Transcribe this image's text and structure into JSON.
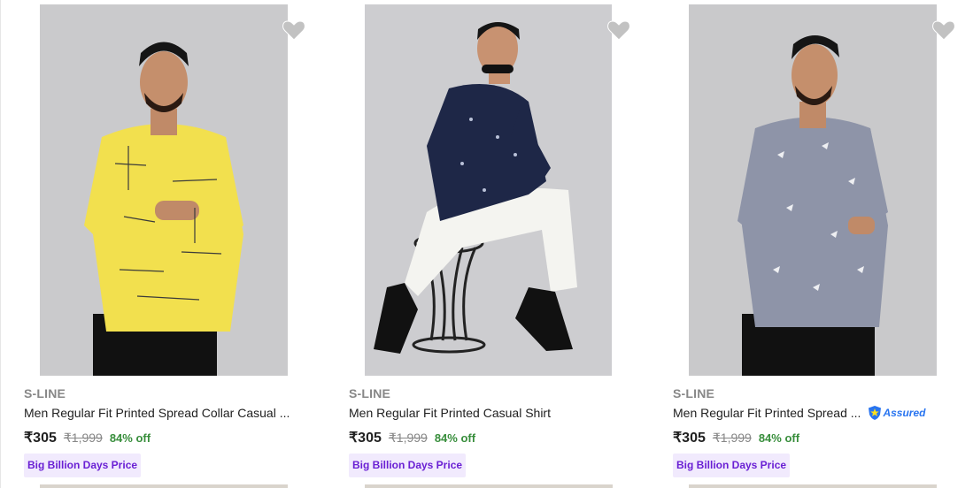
{
  "products": [
    {
      "brand": "S-LINE",
      "title": "Men Regular Fit Printed Spread Collar Casual ...",
      "price": "₹305",
      "mrp": "₹1,999",
      "discount": "84% off",
      "badge": "Big Billion Days Price",
      "assured": "",
      "shirt_color": "#f2e04e",
      "wishlist_icon": "heart-icon"
    },
    {
      "brand": "S-LINE",
      "title": "Men Regular Fit Printed Casual Shirt",
      "price": "₹305",
      "mrp": "₹1,999",
      "discount": "84% off",
      "badge": "Big Billion Days Price",
      "assured": "",
      "shirt_color": "#1e2747",
      "wishlist_icon": "heart-icon"
    },
    {
      "brand": "S-LINE",
      "title": "Men Regular Fit Printed Spread ...",
      "price": "₹305",
      "mrp": "₹1,999",
      "discount": "84% off",
      "badge": "Big Billion Days Price",
      "assured": "Assured",
      "shirt_color": "#8e94a8",
      "wishlist_icon": "heart-icon"
    }
  ],
  "colors": {
    "price_off": "#388e3c",
    "badge_text": "#6a20d4",
    "badge_bg": "#f1eafd",
    "assured_blue": "#2874f0",
    "image_bg": "#c9c9cb"
  }
}
